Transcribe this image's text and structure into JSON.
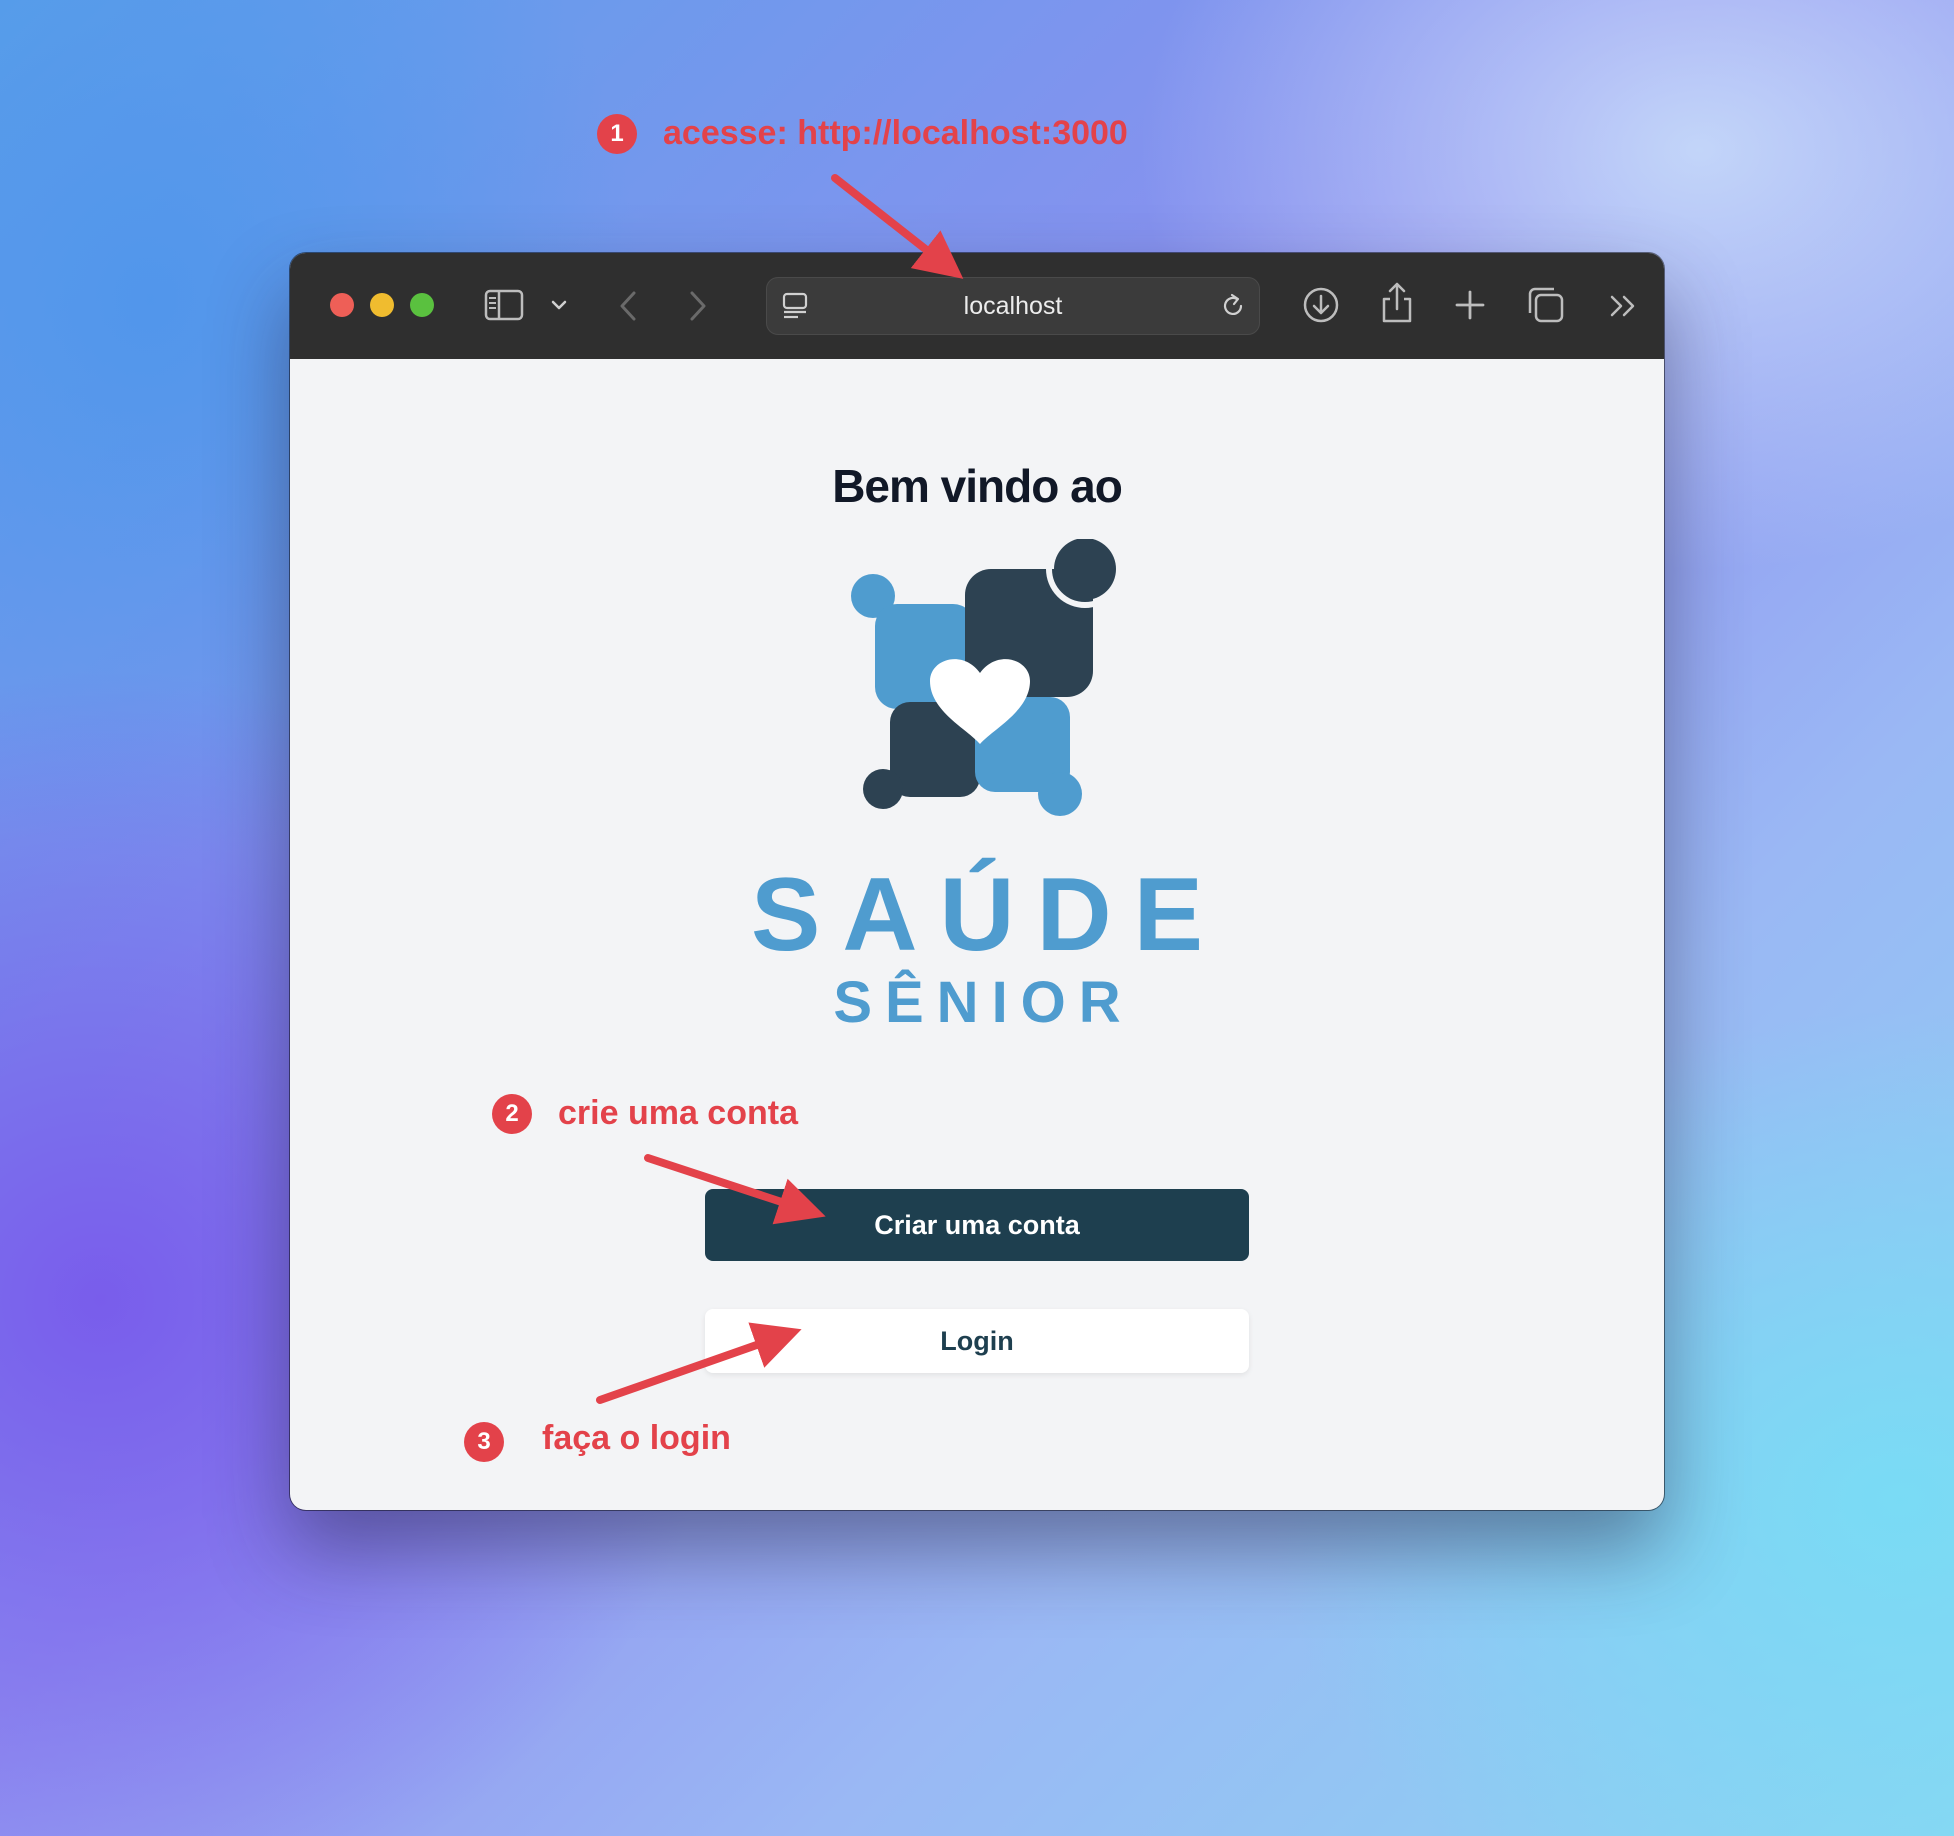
{
  "annotations": [
    {
      "number": "1",
      "text": "acesse: http://localhost:3000"
    },
    {
      "number": "2",
      "text": "crie uma conta"
    },
    {
      "number": "3",
      "text": "faça o login"
    }
  ],
  "browser": {
    "address": "localhost",
    "icons": [
      "sidebar-icon",
      "chevron-down-icon",
      "back-icon",
      "forward-icon",
      "page-menu-icon",
      "reload-icon",
      "download-icon",
      "share-icon",
      "new-tab-icon",
      "tabs-overview-icon",
      "more-icon"
    ]
  },
  "page": {
    "heading": "Bem vindo ao",
    "logo": {
      "line1": "SAÚDE",
      "line2": "SÊNIOR"
    },
    "create_account_label": "Criar uma conta",
    "login_label": "Login"
  },
  "colors": {
    "annotation": "#e3424a",
    "primary_button": "#1e3f4f",
    "logo_light": "#4f9ccf",
    "logo_dark": "#2d4252"
  }
}
